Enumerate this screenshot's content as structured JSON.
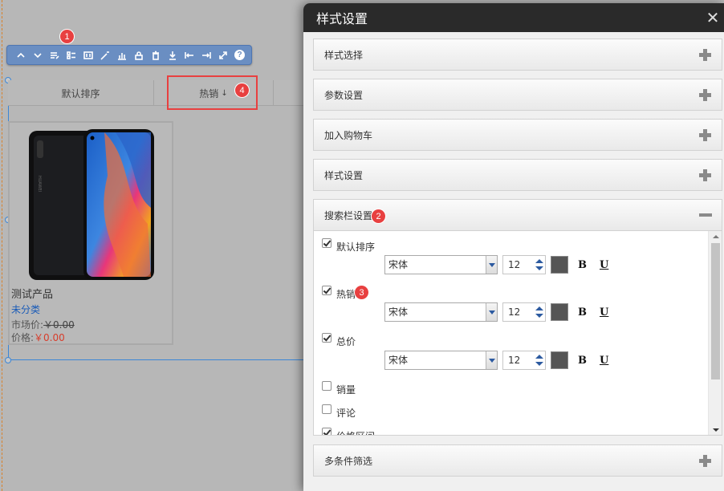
{
  "canvas": {
    "sort_tabs": [
      {
        "label": "默认排序"
      },
      {
        "label": "热销",
        "arrow": "↓"
      },
      {
        "label": ""
      }
    ],
    "product": {
      "name": "测试产品",
      "category": "未分类",
      "market_label": "市场价:",
      "market_price": "￥0.00",
      "price_label": "价格:",
      "price": "￥0.00"
    },
    "toolbar": {
      "icons": [
        "move-up-icon",
        "move-down-icon",
        "edit-icon",
        "list-layout-icon",
        "data-settings-icon",
        "magic-wand-icon",
        "chart-icon",
        "lock-icon",
        "delete-icon",
        "download-icon",
        "align-left-icon",
        "align-right-icon",
        "expand-icon",
        "help-icon"
      ],
      "help_glyph": "?"
    }
  },
  "badges": {
    "b1": "1",
    "b2": "2",
    "b3": "3",
    "b4": "4"
  },
  "dialog": {
    "title": "样式设置",
    "close_glyph": "✕",
    "sections": [
      {
        "label": "样式选择",
        "state": "collapsed"
      },
      {
        "label": "参数设置",
        "state": "collapsed"
      },
      {
        "label": "加入购物车",
        "state": "collapsed"
      },
      {
        "label": "样式设置",
        "state": "collapsed"
      },
      {
        "label": "搜索栏设置",
        "state": "expanded"
      },
      {
        "label": "多条件筛选",
        "state": "collapsed"
      }
    ],
    "search_options": [
      {
        "label": "默认排序",
        "checked": true,
        "font": "宋体",
        "size": "12",
        "color": "#555555",
        "bold": "B",
        "underline": "U"
      },
      {
        "label": "热销",
        "checked": true,
        "font": "宋体",
        "size": "12",
        "color": "#555555",
        "bold": "B",
        "underline": "U"
      },
      {
        "label": "总价",
        "checked": true,
        "font": "宋体",
        "size": "12",
        "color": "#555555",
        "bold": "B",
        "underline": "U"
      },
      {
        "label": "销量",
        "checked": false
      },
      {
        "label": "评论",
        "checked": false
      },
      {
        "label": "价格区间",
        "checked": true
      }
    ]
  }
}
